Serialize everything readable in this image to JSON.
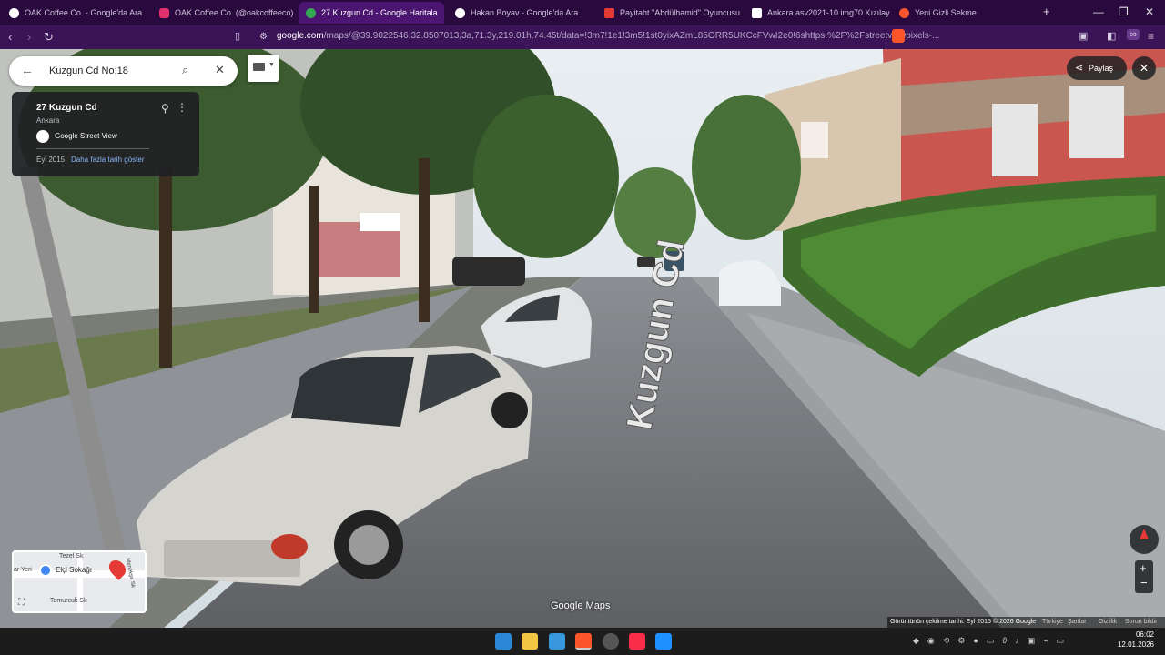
{
  "browser": {
    "tabs": [
      {
        "label": "OAK Coffee Co. - Google'da Ara",
        "color": "#ffffff"
      },
      {
        "label": "OAK Coffee Co. (@oakcoffeeco) • Ins",
        "color": "#e1306c"
      },
      {
        "label": "27 Kuzgun Cd - Google Haritala",
        "color": "#34a853"
      },
      {
        "label": "Hakan Boyav - Google'da Ara",
        "color": "#ffffff"
      },
      {
        "label": "Payitaht \"Abdülhamid\" Oyuncusu M",
        "color": "#e53935"
      },
      {
        "label": "Ankara asv2021-10 img70 Kızılay Sq",
        "color": "#ffffff"
      },
      {
        "label": "Yeni Gizli Sekme",
        "color": "#fb542b"
      }
    ],
    "url_main": "google.com",
    "url_rest": "/maps/@39.9022546,32.8507013,3a,71.3y,219.01h,74.45t/data=!3m7!1e1!3m5!1st0yixAZmL85ORR5UKCcFVwI2e0!6shttps:%2F%2Fstreetviewpixels-...",
    "new_tab": "+"
  },
  "search": {
    "query": "Kuzgun Cd No:18"
  },
  "info": {
    "title": "27 Kuzgun Cd",
    "subtitle": "Ankara",
    "source": "Google Street View",
    "date": "Eyl 2015",
    "more_dates": "Daha fazla tarih göster"
  },
  "share": {
    "label": "Paylaş"
  },
  "street_label": "Kuzgun Cd",
  "watermark": "Google Maps",
  "minimap": {
    "labels": [
      "Tezel Sk",
      "Elçi Sokağı",
      "Tomurcuk Sk",
      "Menekşe Sk",
      "ar Yeri"
    ]
  },
  "footer": {
    "capture_date": "Görüntünün çekilme tarihi: Eyl 2015",
    "copyright": "© 2026 Google",
    "links": [
      "Türkiye",
      "Şartlar",
      "Gizlilik",
      "Sorun bildir"
    ]
  },
  "taskbar": {
    "time": "06:02",
    "date": "12.01.2026"
  }
}
